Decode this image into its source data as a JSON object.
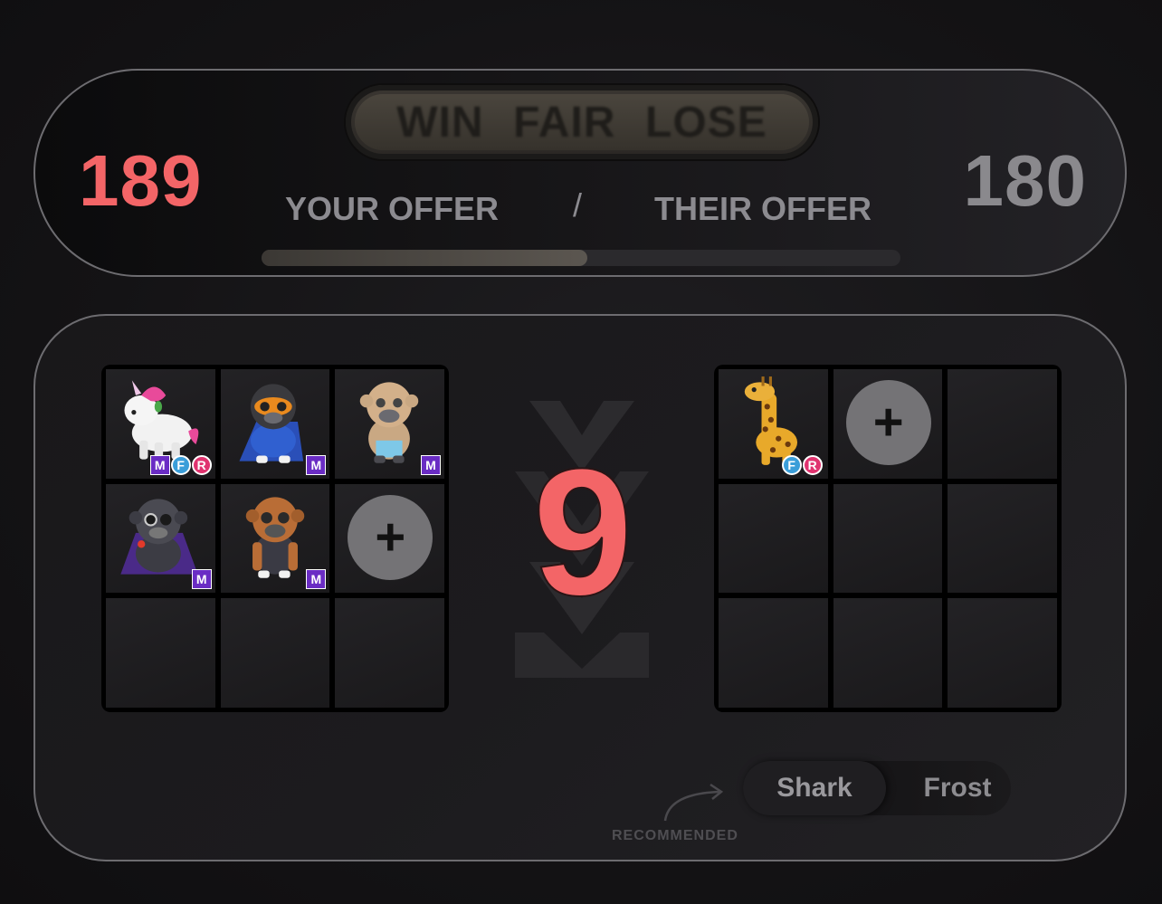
{
  "verdict": {
    "options": [
      "WIN",
      "FAIR",
      "LOSE"
    ]
  },
  "offers": {
    "your_value": "189",
    "their_value": "180",
    "your_label": "YOUR OFFER",
    "their_label": "THEIR OFFER",
    "separator": "/",
    "balance_fraction": 0.51
  },
  "difference": "9",
  "your_items": [
    {
      "pet": "unicorn",
      "badges": [
        "M",
        "F",
        "R"
      ]
    },
    {
      "pet": "superhero-monkey",
      "badges": [
        "M"
      ]
    },
    {
      "pet": "tan-monkey",
      "badges": [
        "M"
      ]
    },
    {
      "pet": "vampire-monkey",
      "badges": [
        "M"
      ]
    },
    {
      "pet": "brown-monkey",
      "badges": [
        "M"
      ]
    }
  ],
  "their_items": [
    {
      "pet": "giraffe",
      "badges": [
        "F",
        "R"
      ]
    }
  ],
  "mode": {
    "options": [
      "Shark",
      "Frost"
    ],
    "selected": "Shark",
    "hint": "RECOMMENDED"
  },
  "colors": {
    "accent": "#f36567",
    "muted": "#8a898d",
    "mega_badge": "#6a2cc4",
    "fly_badge": "#3b9ed9",
    "ride_badge": "#e0336f"
  }
}
